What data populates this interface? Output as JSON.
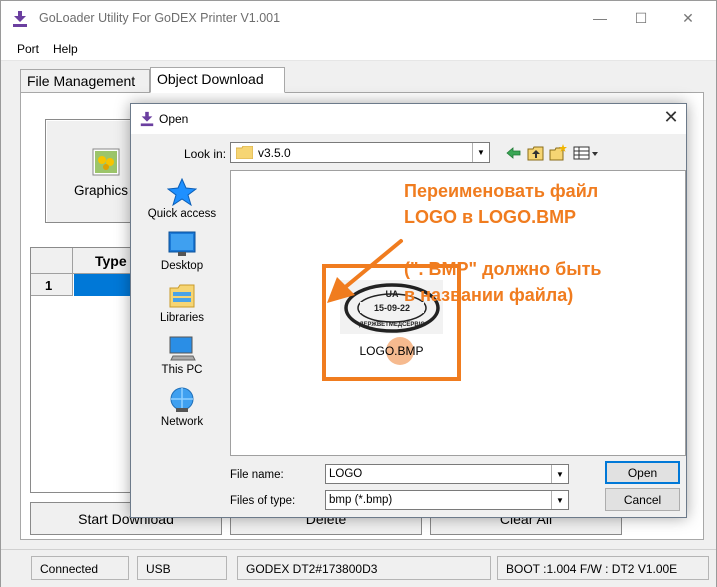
{
  "window": {
    "title": "GoLoader Utility For GoDEX Printer  V1.001",
    "minimize": "—",
    "maximize": "☐",
    "close": "✕"
  },
  "menu": {
    "items": [
      "Port",
      "Help"
    ]
  },
  "tabs": [
    "File Management",
    "Object Download"
  ],
  "active_tab": "Object Download",
  "object_panel": {
    "graphics_label": "Graphics",
    "grid_type_header": "Type",
    "grid_row_number": "1"
  },
  "bottom_buttons": [
    "Start Download",
    "Delete",
    "Clear All"
  ],
  "status_bar": {
    "connection": "Connected",
    "port": "USB",
    "printer": "GODEX DT2#173800D3",
    "firmware": "BOOT :1.004  F/W : DT2 V1.00E"
  },
  "dialog": {
    "title": "Open",
    "close": "✕",
    "look_in_label": "Look in:",
    "look_in_value": "v3.5.0",
    "places": [
      "Quick access",
      "Desktop",
      "Libraries",
      "This PC",
      "Network"
    ],
    "file": {
      "name": "LOGO.BMP",
      "stamp_text_top": "UA",
      "stamp_text_mid": "15-09-22",
      "stamp_text_bottom": "ДЕРЖВЕТМЕДСЕРВІС"
    },
    "file_name_label": "File name:",
    "file_name_value": "LOGO",
    "files_of_type_label": "Files of type:",
    "files_of_type_value": "bmp (*.bmp)",
    "open_button": "Open",
    "cancel_button": "Cancel"
  },
  "annotation": {
    "line1": "Переименовать файл",
    "line2": " LOGO в LOGO.BMP",
    "line3": "(\". BMP\" должно быть",
    "line4": "в названии файла)",
    "color": "#f07c1f"
  }
}
